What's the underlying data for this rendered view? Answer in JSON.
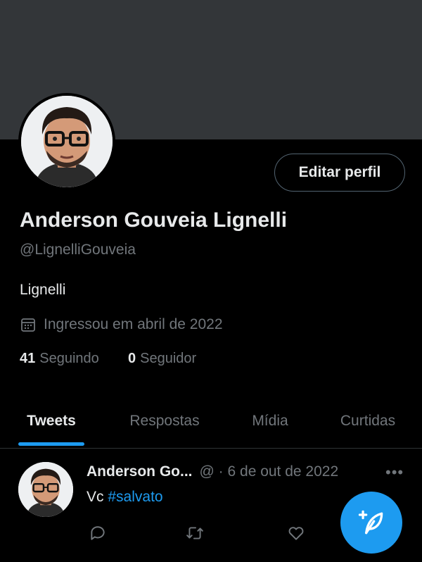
{
  "profile": {
    "edit_label": "Editar perfil",
    "name": "Anderson Gouveia Lignelli",
    "handle": "@LignelliGouveia",
    "bio": "Lignelli",
    "joined": "Ingressou em abril de 2022",
    "following_count": "41",
    "following_label": "Seguindo",
    "followers_count": "0",
    "followers_label": "Seguidor"
  },
  "tabs": [
    {
      "label": "Tweets",
      "active": true
    },
    {
      "label": "Respostas",
      "active": false
    },
    {
      "label": "Mídia",
      "active": false
    },
    {
      "label": "Curtidas",
      "active": false
    }
  ],
  "tweet": {
    "author": "Anderson Go...",
    "meta": "@ · 6 de out de 2022",
    "text": "Vc",
    "hashtag": "#salvato"
  },
  "colors": {
    "accent": "#1d9bf0",
    "banner": "#333639",
    "background": "#000000",
    "muted_text": "#71767b"
  },
  "icons": [
    "calendar-icon",
    "more-icon",
    "reply-icon",
    "retweet-icon",
    "like-icon",
    "compose-icon"
  ]
}
